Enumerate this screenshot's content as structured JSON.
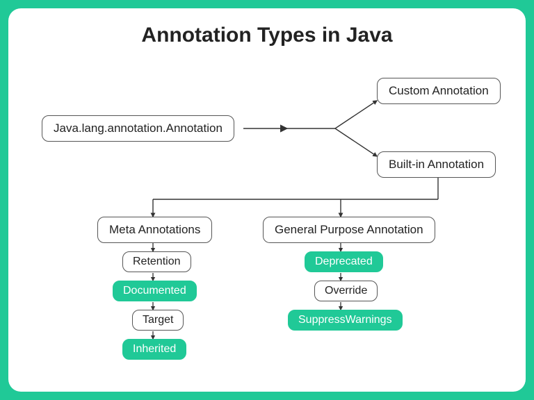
{
  "title": "Annotation Types in Java",
  "root": "Java.lang.annotation.Annotation",
  "custom": "Custom Annotation",
  "builtin": "Built-in Annotation",
  "metaHeader": "Meta Annotations",
  "generalHeader": "General Purpose Annotation",
  "meta": {
    "retention": "Retention",
    "documented": "Documented",
    "target": "Target",
    "inherited": "Inherited"
  },
  "general": {
    "deprecated": "Deprecated",
    "override": "Override",
    "suppress": "SuppressWarnings"
  },
  "colors": {
    "green": "#20c997"
  }
}
